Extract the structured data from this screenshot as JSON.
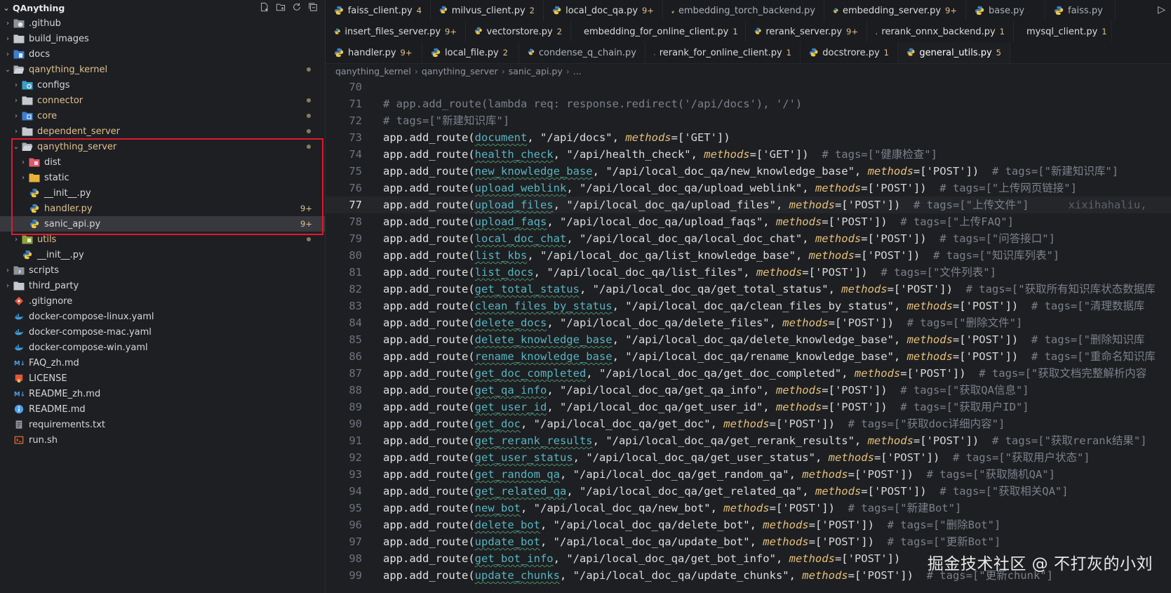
{
  "explorer": {
    "title": "QAnything",
    "items": [
      {
        "label": ".github",
        "depth": 1,
        "kind": "folder",
        "icon": "github-folder-icon",
        "expanded": false
      },
      {
        "label": "build_images",
        "depth": 1,
        "kind": "folder",
        "icon": "folder-icon",
        "expanded": false
      },
      {
        "label": "docs",
        "depth": 1,
        "kind": "folder",
        "icon": "docs-folder-icon",
        "expanded": false
      },
      {
        "label": "qanything_kernel",
        "depth": 1,
        "kind": "folder",
        "icon": "folder-open-icon",
        "expanded": true,
        "modified": true,
        "dot": true
      },
      {
        "label": "configs",
        "depth": 2,
        "kind": "folder",
        "icon": "config-folder-icon",
        "expanded": false
      },
      {
        "label": "connector",
        "depth": 2,
        "kind": "folder",
        "icon": "folder-icon",
        "expanded": false,
        "modified": true,
        "dot": true
      },
      {
        "label": "core",
        "depth": 2,
        "kind": "folder",
        "icon": "core-folder-icon",
        "expanded": false,
        "modified": true,
        "dot": true
      },
      {
        "label": "dependent_server",
        "depth": 2,
        "kind": "folder",
        "icon": "folder-icon",
        "expanded": false,
        "modified": true,
        "dot": true
      },
      {
        "label": "qanything_server",
        "depth": 2,
        "kind": "folder",
        "icon": "folder-open-icon",
        "expanded": true,
        "modified": true,
        "dot": true
      },
      {
        "label": "dist",
        "depth": 3,
        "kind": "folder",
        "icon": "dist-folder-icon",
        "expanded": false
      },
      {
        "label": "static",
        "depth": 3,
        "kind": "folder",
        "icon": "static-folder-icon",
        "expanded": false
      },
      {
        "label": "__init__.py",
        "depth": 3,
        "kind": "file",
        "icon": "python-file-icon"
      },
      {
        "label": "handler.py",
        "depth": 3,
        "kind": "file",
        "icon": "python-file-icon",
        "modified": true,
        "badge": "9+"
      },
      {
        "label": "sanic_api.py",
        "depth": 3,
        "kind": "file",
        "icon": "python-file-icon",
        "badge": "9+",
        "selected": true
      },
      {
        "label": "utils",
        "depth": 2,
        "kind": "folder",
        "icon": "utils-folder-icon",
        "expanded": false,
        "modified": true,
        "dot": true
      },
      {
        "label": "__init__.py",
        "depth": 2,
        "kind": "file",
        "icon": "python-file-icon"
      },
      {
        "label": "scripts",
        "depth": 1,
        "kind": "folder",
        "icon": "scripts-folder-icon",
        "expanded": false
      },
      {
        "label": "third_party",
        "depth": 1,
        "kind": "folder",
        "icon": "folder-icon",
        "expanded": false
      },
      {
        "label": ".gitignore",
        "depth": 1,
        "kind": "file",
        "icon": "git-file-icon"
      },
      {
        "label": "docker-compose-linux.yaml",
        "depth": 1,
        "kind": "file",
        "icon": "docker-file-icon"
      },
      {
        "label": "docker-compose-mac.yaml",
        "depth": 1,
        "kind": "file",
        "icon": "docker-file-icon"
      },
      {
        "label": "docker-compose-win.yaml",
        "depth": 1,
        "kind": "file",
        "icon": "docker-file-icon"
      },
      {
        "label": "FAQ_zh.md",
        "depth": 1,
        "kind": "file",
        "icon": "markdown-file-icon"
      },
      {
        "label": "LICENSE",
        "depth": 1,
        "kind": "file",
        "icon": "license-file-icon"
      },
      {
        "label": "README_zh.md",
        "depth": 1,
        "kind": "file",
        "icon": "markdown-file-icon"
      },
      {
        "label": "README.md",
        "depth": 1,
        "kind": "file",
        "icon": "info-file-icon"
      },
      {
        "label": "requirements.txt",
        "depth": 1,
        "kind": "file",
        "icon": "text-file-icon"
      },
      {
        "label": "run.sh",
        "depth": 1,
        "kind": "file",
        "icon": "shell-file-icon"
      }
    ]
  },
  "tabs": {
    "rows": [
      [
        {
          "label": "faiss_client.py",
          "badge": "4"
        },
        {
          "label": "milvus_client.py",
          "badge": "2"
        },
        {
          "label": "local_doc_qa.py",
          "badge": "9+"
        },
        {
          "label": "embedding_torch_backend.py",
          "plain": true
        },
        {
          "label": "embedding_server.py",
          "badge": "9+"
        },
        {
          "label": "base.py",
          "plain": true
        },
        {
          "label": "faiss.py",
          "plain": true
        }
      ],
      [
        {
          "label": "insert_files_server.py",
          "badge": "9+"
        },
        {
          "label": "vectorstore.py",
          "badge": "2"
        },
        {
          "label": "embedding_for_online_client.py",
          "badge": "1"
        },
        {
          "label": "rerank_server.py",
          "badge": "9+"
        },
        {
          "label": "rerank_onnx_backend.py",
          "badge": "1"
        },
        {
          "label": "mysql_client.py",
          "badge": "1"
        }
      ],
      [
        {
          "label": "handler.py",
          "badge": "9+"
        },
        {
          "label": "local_file.py",
          "badge": "2"
        },
        {
          "label": "condense_q_chain.py",
          "plain": true
        },
        {
          "label": "rerank_for_online_client.py",
          "badge": "1"
        },
        {
          "label": "docstrore.py",
          "badge": "1"
        },
        {
          "label": "general_utils.py",
          "badge": "5",
          "active": true
        }
      ]
    ]
  },
  "breadcrumb": [
    "qanything_kernel",
    "qanything_server",
    "sanic_api.py",
    "..."
  ],
  "code": {
    "current_line": 77,
    "ghost_text": "xixihahaliu,",
    "lines": [
      {
        "n": "70",
        "type": "blank"
      },
      {
        "n": "71",
        "type": "comment",
        "text": "# app.add_route(lambda req: response.redirect('/api/docs'), '/')"
      },
      {
        "n": "72",
        "type": "comment",
        "text": "# tags=[\"新建知识库\"]"
      },
      {
        "n": "73",
        "type": "route",
        "fn": "document",
        "path": "\"/api/docs\"",
        "method": "'GET'",
        "tag": ""
      },
      {
        "n": "74",
        "type": "route",
        "fn": "health_check",
        "path": "\"/api/health_check\"",
        "method": "'GET'",
        "tag": "# tags=[\"健康检查\"]"
      },
      {
        "n": "75",
        "type": "route",
        "fn": "new_knowledge_base",
        "path": "\"/api/local_doc_qa/new_knowledge_base\"",
        "method": "'POST'",
        "tag": "# tags=[\"新建知识库\"]"
      },
      {
        "n": "76",
        "type": "route",
        "fn": "upload_weblink",
        "path": "\"/api/local_doc_qa/upload_weblink\"",
        "method": "'POST'",
        "tag": "# tags=[\"上传网页链接\"]"
      },
      {
        "n": "77",
        "type": "route",
        "fn": "upload_files",
        "path": "\"/api/local_doc_qa/upload_files\"",
        "method": "'POST'",
        "tag": "# tags=[\"上传文件\"]"
      },
      {
        "n": "78",
        "type": "route",
        "fn": "upload_faqs",
        "path": "\"/api/local_doc_qa/upload_faqs\"",
        "method": "'POST'",
        "tag": "# tags=[\"上传FAQ\"]"
      },
      {
        "n": "79",
        "type": "route",
        "fn": "local_doc_chat",
        "path": "\"/api/local_doc_qa/local_doc_chat\"",
        "method": "'POST'",
        "tag": "# tags=[\"问答接口\"]"
      },
      {
        "n": "80",
        "type": "route",
        "fn": "list_kbs",
        "path": "\"/api/local_doc_qa/list_knowledge_base\"",
        "method": "'POST'",
        "tag": "# tags=[\"知识库列表\"]"
      },
      {
        "n": "81",
        "type": "route",
        "fn": "list_docs",
        "path": "\"/api/local_doc_qa/list_files\"",
        "method": "'POST'",
        "tag": "# tags=[\"文件列表\"]"
      },
      {
        "n": "82",
        "type": "route",
        "fn": "get_total_status",
        "path": "\"/api/local_doc_qa/get_total_status\"",
        "method": "'POST'",
        "tag": "# tags=[\"获取所有知识库状态数据库"
      },
      {
        "n": "83",
        "type": "route",
        "fn": "clean_files_by_status",
        "path": "\"/api/local_doc_qa/clean_files_by_status\"",
        "method": "'POST'",
        "tag": "# tags=[\"清理数据库"
      },
      {
        "n": "84",
        "type": "route",
        "fn": "delete_docs",
        "path": "\"/api/local_doc_qa/delete_files\"",
        "method": "'POST'",
        "tag": "# tags=[\"删除文件\"]"
      },
      {
        "n": "85",
        "type": "route",
        "fn": "delete_knowledge_base",
        "path": "\"/api/local_doc_qa/delete_knowledge_base\"",
        "method": "'POST'",
        "tag": "# tags=[\"删除知识库"
      },
      {
        "n": "86",
        "type": "route",
        "fn": "rename_knowledge_base",
        "path": "\"/api/local_doc_qa/rename_knowledge_base\"",
        "method": "'POST'",
        "tag": "# tags=[\"重命名知识库"
      },
      {
        "n": "87",
        "type": "route",
        "fn": "get_doc_completed",
        "path": "\"/api/local_doc_qa/get_doc_completed\"",
        "method": "'POST'",
        "tag": "# tags=[\"获取文档完整解析内容"
      },
      {
        "n": "88",
        "type": "route",
        "fn": "get_qa_info",
        "path": "\"/api/local_doc_qa/get_qa_info\"",
        "method": "'POST'",
        "tag": "# tags=[\"获取QA信息\"]"
      },
      {
        "n": "89",
        "type": "route",
        "fn": "get_user_id",
        "path": "\"/api/local_doc_qa/get_user_id\"",
        "method": "'POST'",
        "tag": "# tags=[\"获取用户ID\"]"
      },
      {
        "n": "90",
        "type": "route",
        "fn": "get_doc",
        "path": "\"/api/local_doc_qa/get_doc\"",
        "method": "'POST'",
        "tag": "# tags=[\"获取doc详细内容\"]"
      },
      {
        "n": "91",
        "type": "route",
        "fn": "get_rerank_results",
        "path": "\"/api/local_doc_qa/get_rerank_results\"",
        "method": "'POST'",
        "tag": "# tags=[\"获取rerank结果\"]"
      },
      {
        "n": "92",
        "type": "route",
        "fn": "get_user_status",
        "path": "\"/api/local_doc_qa/get_user_status\"",
        "method": "'POST'",
        "tag": "# tags=[\"获取用户状态\"]"
      },
      {
        "n": "93",
        "type": "route",
        "fn": "get_random_qa",
        "path": "\"/api/local_doc_qa/get_random_qa\"",
        "method": "'POST'",
        "tag": "# tags=[\"获取随机QA\"]"
      },
      {
        "n": "94",
        "type": "route",
        "fn": "get_related_qa",
        "path": "\"/api/local_doc_qa/get_related_qa\"",
        "method": "'POST'",
        "tag": "# tags=[\"获取相关QA\"]"
      },
      {
        "n": "95",
        "type": "route",
        "fn": "new_bot",
        "path": "\"/api/local_doc_qa/new_bot\"",
        "method": "'POST'",
        "tag": "# tags=[\"新建Bot\"]"
      },
      {
        "n": "96",
        "type": "route",
        "fn": "delete_bot",
        "path": "\"/api/local_doc_qa/delete_bot\"",
        "method": "'POST'",
        "tag": "# tags=[\"删除Bot\"]"
      },
      {
        "n": "97",
        "type": "route",
        "fn": "update_bot",
        "path": "\"/api/local_doc_qa/update_bot\"",
        "method": "'POST'",
        "tag": "# tags=[\"更新Bot\"]"
      },
      {
        "n": "98",
        "type": "route",
        "fn": "get_bot_info",
        "path": "\"/api/local_doc_qa/get_bot_info\"",
        "method": "'POST'",
        "tag": ""
      },
      {
        "n": "99",
        "type": "route",
        "fn": "update_chunks",
        "path": "\"/api/local_doc_qa/update_chunks\"",
        "method": "'POST'",
        "tag": "# tags=[\"更新chunk\"]"
      }
    ]
  },
  "watermark": "掘金技术社区 @ 不打灰的小刘"
}
